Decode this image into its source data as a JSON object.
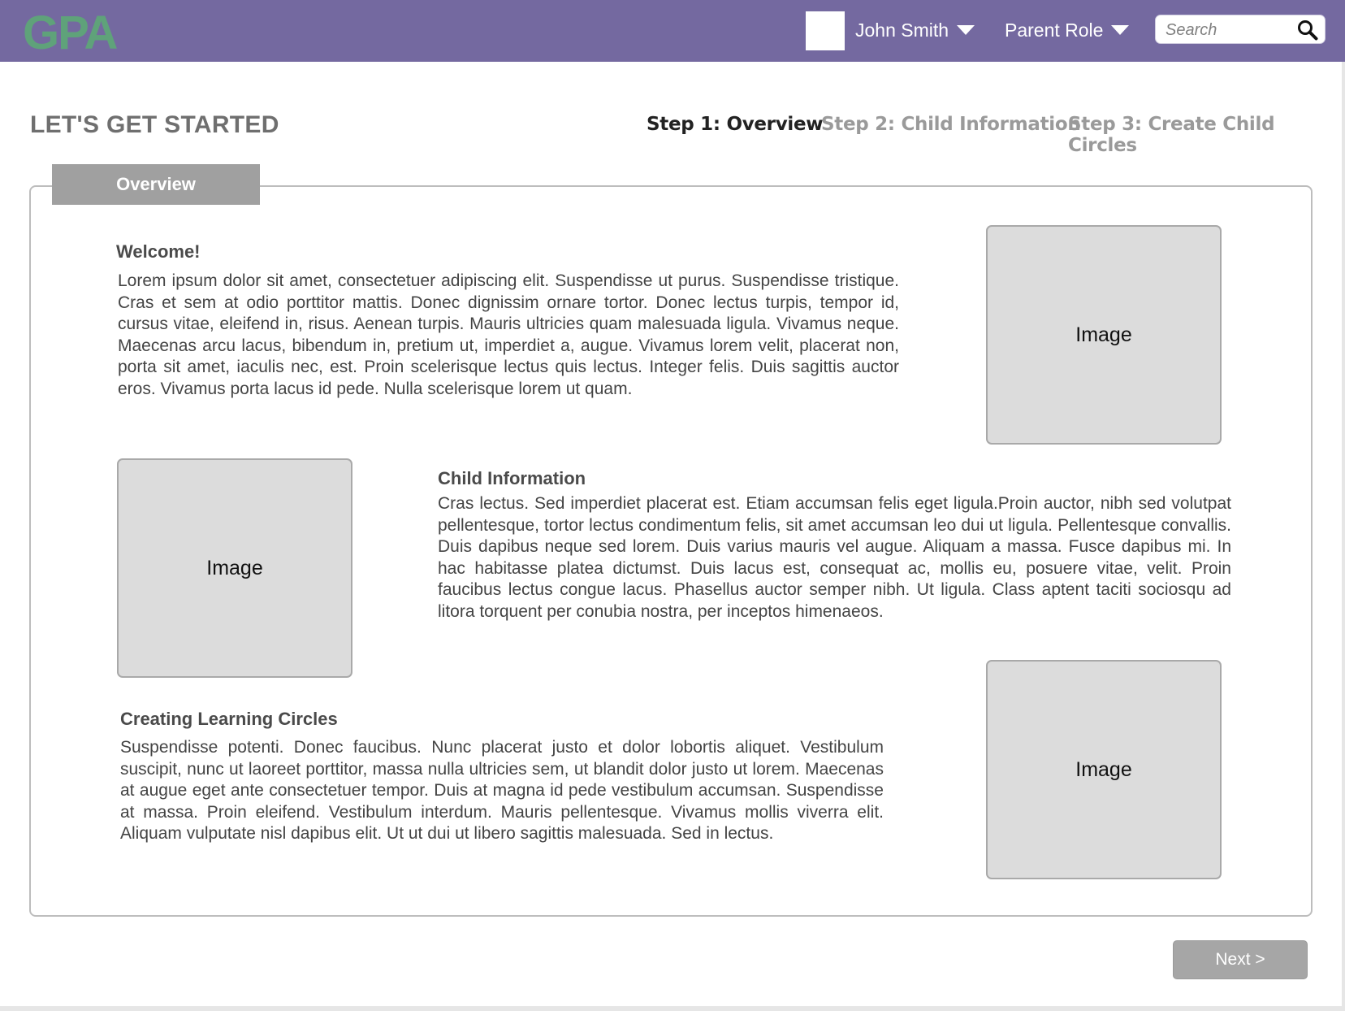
{
  "header": {
    "logo_text": "GPA",
    "user_name": "John Smith",
    "role": "Parent Role",
    "search_placeholder": "Search",
    "colors": {
      "bar": "#7469a0",
      "logo_green": "#5fa27a"
    }
  },
  "page": {
    "title": "LET'S GET STARTED",
    "steps": [
      {
        "label": "Step 1: Overview",
        "active": true
      },
      {
        "label": "Step 2: Child Information",
        "active": false
      },
      {
        "label": "Step 3: Create Child Circles",
        "active": false
      }
    ],
    "tab_label": "Overview"
  },
  "sections": [
    {
      "title": "Welcome!",
      "text": "Lorem ipsum dolor sit amet, consectetuer adipiscing elit. Suspendisse ut purus. Suspendisse tristique. Cras et sem at odio porttitor mattis. Donec dignissim ornare tortor. Donec lectus turpis, tempor id, cursus vitae, eleifend in, risus. Aenean turpis. Mauris ultricies quam malesuada ligula. Vivamus neque. Maecenas arcu lacus, bibendum in, pretium ut, imperdiet a, augue. Vivamus lorem velit, placerat non, porta sit amet, iaculis nec, est. Proin scelerisque lectus quis lectus. Integer felis. Duis sagittis auctor eros. Vivamus porta lacus id pede. Nulla scelerisque lorem ut quam.",
      "image_label": "Image"
    },
    {
      "title": "Child Information",
      "text": "Cras lectus. Sed imperdiet placerat est. Etiam accumsan felis eget ligula.Proin auctor, nibh sed volutpat pellentesque, tortor lectus condimentum felis, sit amet accumsan leo dui ut ligula. Pellentesque convallis. Duis dapibus neque sed lorem. Duis varius mauris vel augue. Aliquam a massa. Fusce dapibus mi. In hac habitasse platea dictumst. Duis lacus est, consequat ac, mollis eu, posuere vitae, velit. Proin faucibus lectus congue lacus. Phasellus auctor semper nibh. Ut ligula. Class aptent taciti sociosqu ad litora torquent per conubia nostra, per inceptos himenaeos.",
      "image_label": "Image"
    },
    {
      "title": "Creating Learning Circles",
      "text": "Suspendisse potenti. Donec faucibus. Nunc placerat justo et dolor lobortis aliquet. Vestibulum suscipit, nunc ut laoreet porttitor, massa nulla ultricies sem, ut blandit dolor justo ut lorem. Maecenas at augue eget ante consectetuer tempor. Duis at magna id pede vestibulum accumsan. Suspendisse at massa. Proin eleifend. Vestibulum interdum. Mauris pellentesque. Vivamus mollis viverra elit. Aliquam vulputate nisl dapibus elit. Ut ut dui ut libero sagittis malesuada. Sed in lectus.",
      "image_label": "Image"
    }
  ],
  "footer": {
    "next_label": "Next >"
  }
}
